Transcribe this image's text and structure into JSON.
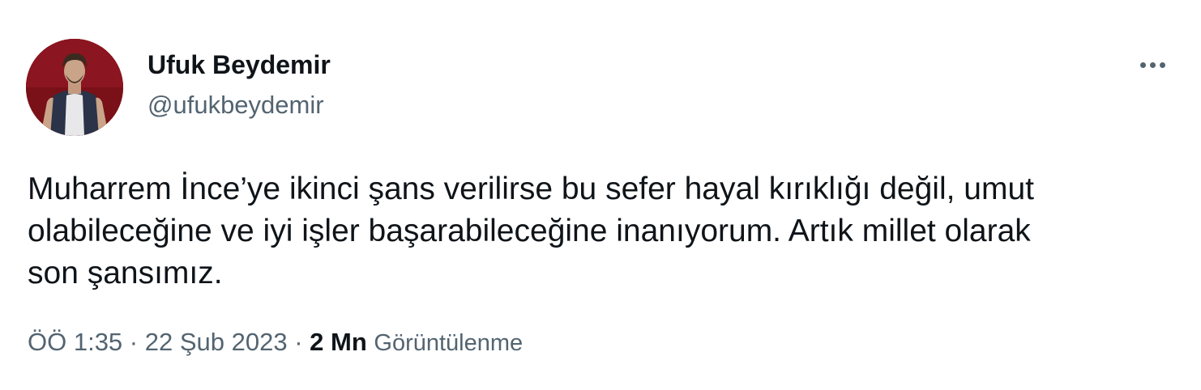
{
  "author": {
    "display_name": "Ufuk Beydemir",
    "handle": "@ufukbeydemir",
    "avatar_icon": "profile-photo"
  },
  "more_button": {
    "icon": "more-horizontal-icon"
  },
  "tweet": {
    "lines": [
      "Muharrem İnce’ye ikinci şans verilirse bu sefer hayal kırıklığı değil, umut",
      "olabileceğine ve iyi işler başarabileceğine inanıyorum. Artık millet olarak",
      "son şansımız."
    ]
  },
  "meta": {
    "time": "ÖÖ 1:35",
    "separator": " · ",
    "date": "22 Şub 2023",
    "views_count": "2 Mn",
    "views_label": "Görüntülenme"
  },
  "colors": {
    "text_primary": "#0f1419",
    "text_secondary": "#536471",
    "avatar_background": "#7a1018"
  }
}
